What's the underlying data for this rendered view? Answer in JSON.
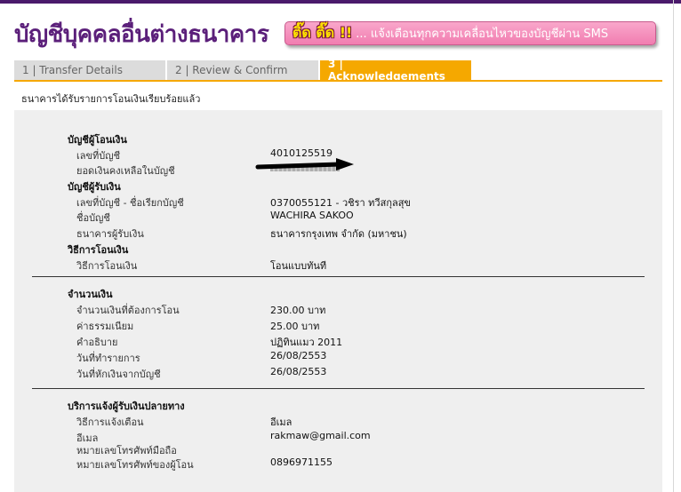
{
  "header": {
    "title": "บัญชีบุคคลอื่นต่างธนาคาร",
    "sms_strong": "ติ๊ด ติ๊ด !!",
    "sms_text": "... แจ้งเตือนทุกความเคลื่อนไหวของบัญชีผ่าน SMS"
  },
  "tabs": [
    {
      "label": "1 | Transfer Details"
    },
    {
      "label": "2 | Review & Confirm"
    },
    {
      "label": "3 | Acknowledgements"
    }
  ],
  "message": "ธนาคารได้รับรายการโอนเงินเรียบร้อยแล้ว",
  "from_account": {
    "heading": "บัญชีผู้โอนเงิน",
    "account_no_label": "เลขที่บัญชี",
    "account_no": "4010125519",
    "balance_label": "ยอดเงินคงเหลือในบัญชี"
  },
  "to_account": {
    "heading": "บัญชีผู้รับเงิน",
    "account_label": "เลขที่บัญชี - ชื่อเรียกบัญชี",
    "account_value": "0370055121 - วชิรา ทวีสกุลสุข",
    "name_label": "ชื่อบัญชี",
    "name_value": "WACHIRA SAKOO",
    "bank_label": "ธนาคารผู้รับเงิน",
    "bank_value": "ธนาคารกรุงเทพ จำกัด (มหาชน)"
  },
  "method": {
    "heading": "วิธีการโอนเงิน",
    "label": "วิธีการโอนเงิน",
    "value": "โอนแบบทันที"
  },
  "amount": {
    "heading": "จำนวนเงิน",
    "transfer_label": "จำนวนเงินที่ต้องการโอน",
    "transfer_value": "230.00 บาท",
    "fee_label": "ค่าธรรมเนียม",
    "fee_value": "25.00 บาท",
    "desc_label": "คำอธิบาย",
    "desc_value": "ปฏิทินแมว 2011",
    "txn_date_label": "วันที่ทำรายการ",
    "txn_date_value": "26/08/2553",
    "debit_date_label": "วันที่หักเงินจากบัญชี",
    "debit_date_value": "26/08/2553"
  },
  "notify": {
    "heading": "บริการแจ้งผู้รับเงินปลายทาง",
    "method_label": "วิธีการแจ้งเตือน",
    "method_value": "อีเมล",
    "email_label": "อีเมล",
    "email_value": "rakmaw@gmail.com",
    "recipient_phone_label": "หมายเลขโทรศัพท์มือถือ",
    "sender_phone_label": "หมายเลขโทรศัพท์ของผู้โอน",
    "sender_phone_value": "0896971155"
  }
}
